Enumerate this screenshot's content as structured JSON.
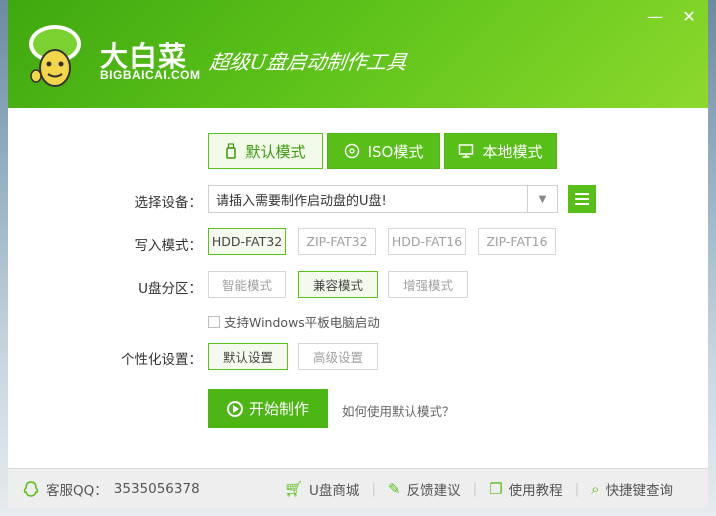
{
  "header": {
    "brand_cn": "大白菜",
    "brand_en": "BIGBAICAI.COM",
    "slogan": "超级U盘启动制作工具",
    "minimize_label": "—",
    "close_label": "✕"
  },
  "tabs": [
    {
      "label": "默认模式",
      "icon": "usb-icon"
    },
    {
      "label": "ISO模式",
      "icon": "disc-icon"
    },
    {
      "label": "本地模式",
      "icon": "monitor-icon"
    }
  ],
  "device": {
    "label": "选择设备：",
    "value": "请插入需要制作启动盘的U盘!"
  },
  "write_mode": {
    "label": "写入模式：",
    "options": [
      "HDD-FAT32",
      "ZIP-FAT32",
      "HDD-FAT16",
      "ZIP-FAT16"
    ]
  },
  "partition": {
    "label": "U盘分区：",
    "options": [
      "智能模式",
      "兼容模式",
      "增强模式"
    ]
  },
  "tablet_support": "支持Windows平板电脑启动",
  "personalize": {
    "label": "个性化设置：",
    "options": [
      "默认设置",
      "高级设置"
    ]
  },
  "start_label": "开始制作",
  "help_link": "如何使用默认模式？",
  "footer": {
    "qq_label": "客服QQ：",
    "qq_number": "3535056378",
    "items": [
      "U盘商城",
      "反馈建议",
      "使用教程",
      "快捷键查询"
    ]
  },
  "colors": {
    "accent": "#57bf17",
    "accent_dark": "#3a9a10"
  }
}
